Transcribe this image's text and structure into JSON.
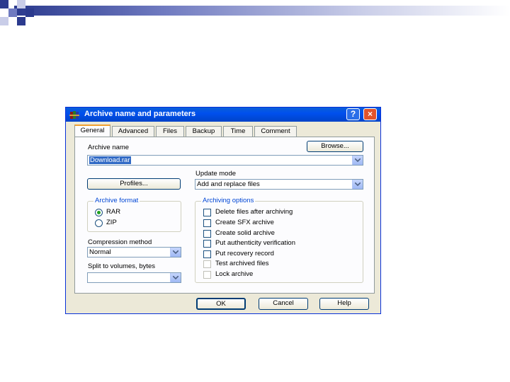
{
  "dialog": {
    "title": "Archive name and parameters",
    "help_glyph": "?",
    "close_glyph": "×"
  },
  "tabs": [
    {
      "label": "General",
      "active": true
    },
    {
      "label": "Advanced"
    },
    {
      "label": "Files"
    },
    {
      "label": "Backup"
    },
    {
      "label": "Time"
    },
    {
      "label": "Comment"
    }
  ],
  "archive_name": {
    "label": "Archive name",
    "browse_label": "Browse...",
    "value": "Download.rar"
  },
  "profiles_label": "Profiles...",
  "update_mode": {
    "label": "Update mode",
    "value": "Add and replace files"
  },
  "archive_format": {
    "title": "Archive format",
    "options": [
      {
        "label": "RAR",
        "selected": true
      },
      {
        "label": "ZIP",
        "selected": false
      }
    ]
  },
  "compression": {
    "label": "Compression method",
    "value": "Normal"
  },
  "split": {
    "label": "Split to volumes, bytes",
    "value": ""
  },
  "archiving_options": {
    "title": "Archiving options",
    "items": [
      {
        "label": "Delete files after archiving",
        "checked": false,
        "enabled": true
      },
      {
        "label": "Create SFX archive",
        "checked": false,
        "enabled": true
      },
      {
        "label": "Create solid archive",
        "checked": false,
        "enabled": true
      },
      {
        "label": "Put authenticity verification",
        "checked": false,
        "enabled": true
      },
      {
        "label": "Put recovery record",
        "checked": false,
        "enabled": true
      },
      {
        "label": "Test archived files",
        "checked": false,
        "enabled": false
      },
      {
        "label": "Lock archive",
        "checked": false,
        "enabled": false
      }
    ]
  },
  "buttons": {
    "ok": "OK",
    "cancel": "Cancel",
    "help": "Help"
  },
  "colors": {
    "titlebar": "#0050ee",
    "dialog_bg": "#ece9d8",
    "group_title": "#0046d5",
    "selection": "#316ac5"
  }
}
